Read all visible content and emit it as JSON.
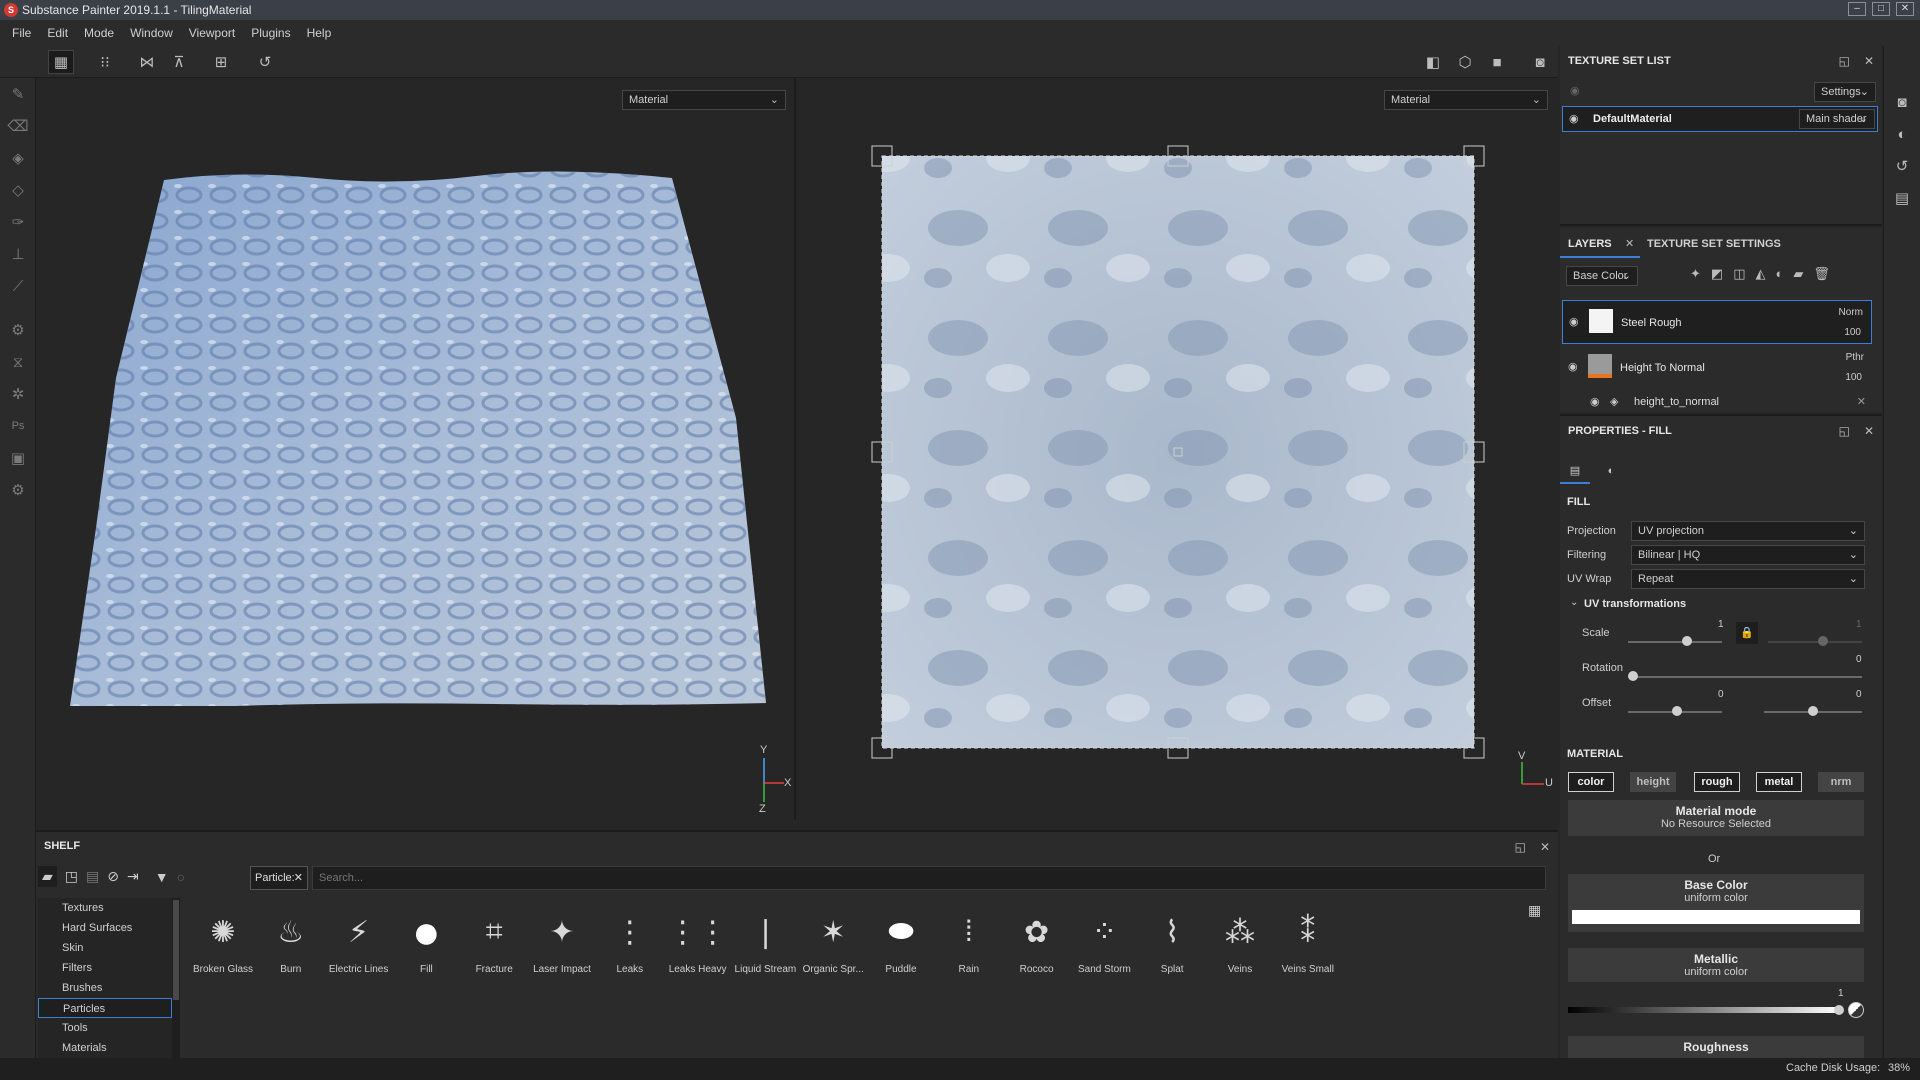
{
  "window": {
    "title": "Substance Painter 2019.1.1 - TilingMaterial",
    "app_icon": "substance-painter-icon"
  },
  "menu": [
    "File",
    "Edit",
    "Mode",
    "Window",
    "Viewport",
    "Plugins",
    "Help"
  ],
  "viewport": {
    "left_channel": "Material",
    "right_channel": "Material",
    "gizmo_3d": {
      "y": "Y",
      "x": "X",
      "z": "Z"
    },
    "gizmo_2d": {
      "v": "V",
      "u": "U"
    }
  },
  "texture_set_list": {
    "title": "TEXTURE SET LIST",
    "settings_label": "Settings",
    "item_name": "DefaultMaterial",
    "shader": "Main shader"
  },
  "layers": {
    "tab_layers": "LAYERS",
    "tab_texture_set_settings": "TEXTURE SET SETTINGS",
    "channel": "Base Color",
    "items": [
      {
        "name": "Steel Rough",
        "blend": "Norm",
        "opacity": "100"
      },
      {
        "name": "Height To Normal",
        "blend": "Pthr",
        "opacity": "100"
      }
    ],
    "sub_item": "height_to_normal"
  },
  "properties": {
    "title": "PROPERTIES - FILL",
    "fill_header": "FILL",
    "projection_label": "Projection",
    "projection_value": "UV projection",
    "filtering_label": "Filtering",
    "filtering_value": "Bilinear | HQ",
    "uvwrap_label": "UV Wrap",
    "uvwrap_value": "Repeat",
    "uvtransform_header": "UV transformations",
    "scale_label": "Scale",
    "scale_value": "1",
    "scale_value_locked": "1",
    "rotation_label": "Rotation",
    "rotation_value": "0",
    "offset_label": "Offset",
    "offset_u": "0",
    "offset_v": "0",
    "material_header": "MATERIAL",
    "mat_buttons": [
      "color",
      "height",
      "rough",
      "metal",
      "nrm"
    ],
    "material_mode_label": "Material mode",
    "material_mode_sub": "No Resource Selected",
    "or_label": "Or",
    "base_color_label": "Base Color",
    "base_color_sub": "uniform color",
    "metallic_label": "Metallic",
    "metallic_sub": "uniform color",
    "metallic_value": "1",
    "roughness_label": "Roughness"
  },
  "shelf": {
    "title": "SHELF",
    "filter_tag": "Particle:",
    "search_placeholder": "Search...",
    "categories": [
      "Textures",
      "Hard Surfaces",
      "Skin",
      "Filters",
      "Brushes",
      "Particles",
      "Tools",
      "Materials"
    ],
    "selected_category": "Particles",
    "items": [
      "Broken Glass",
      "Burn",
      "Electric Lines",
      "Fill",
      "Fracture",
      "Laser Impact",
      "Leaks",
      "Leaks Heavy",
      "Liquid Stream",
      "Organic Spr...",
      "Puddle",
      "Rain",
      "Rococo",
      "Sand Storm",
      "Splat",
      "Veins",
      "Veins Small"
    ]
  },
  "status": {
    "cache_label": "Cache Disk Usage:",
    "cache_value": "38%"
  }
}
